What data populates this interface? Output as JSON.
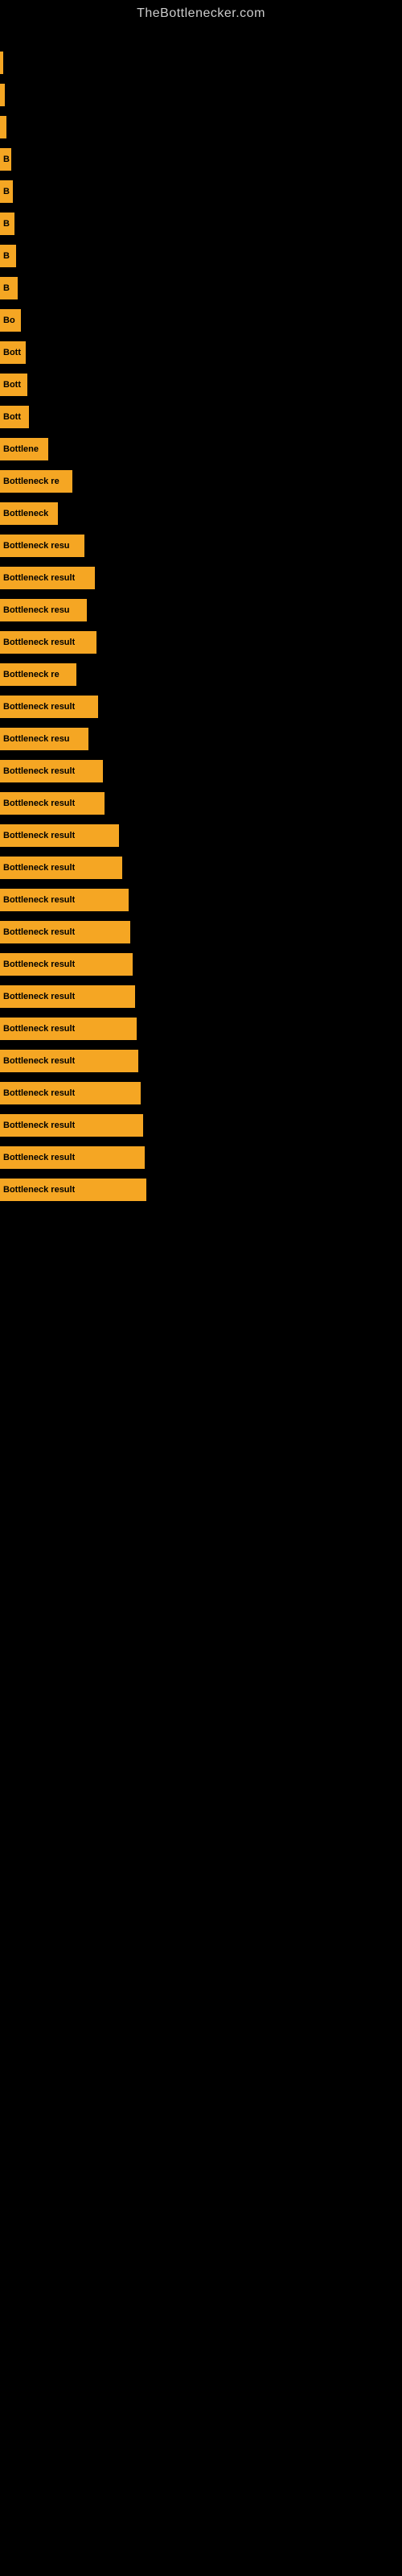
{
  "site": {
    "title": "TheBottlenecker.com"
  },
  "bars": [
    {
      "label": "",
      "width": 4
    },
    {
      "label": "",
      "width": 6
    },
    {
      "label": "",
      "width": 8
    },
    {
      "label": "B",
      "width": 14
    },
    {
      "label": "B",
      "width": 16
    },
    {
      "label": "B",
      "width": 18
    },
    {
      "label": "B",
      "width": 20
    },
    {
      "label": "B",
      "width": 22
    },
    {
      "label": "Bo",
      "width": 26
    },
    {
      "label": "Bott",
      "width": 32
    },
    {
      "label": "Bott",
      "width": 34
    },
    {
      "label": "Bott",
      "width": 36
    },
    {
      "label": "Bottlene",
      "width": 60
    },
    {
      "label": "Bottleneck re",
      "width": 90
    },
    {
      "label": "Bottleneck",
      "width": 72
    },
    {
      "label": "Bottleneck resu",
      "width": 105
    },
    {
      "label": "Bottleneck result",
      "width": 118
    },
    {
      "label": "Bottleneck resu",
      "width": 108
    },
    {
      "label": "Bottleneck result",
      "width": 120
    },
    {
      "label": "Bottleneck re",
      "width": 95
    },
    {
      "label": "Bottleneck result",
      "width": 122
    },
    {
      "label": "Bottleneck resu",
      "width": 110
    },
    {
      "label": "Bottleneck result",
      "width": 128
    },
    {
      "label": "Bottleneck result",
      "width": 130
    },
    {
      "label": "Bottleneck result",
      "width": 148
    },
    {
      "label": "Bottleneck result",
      "width": 152
    },
    {
      "label": "Bottleneck result",
      "width": 160
    },
    {
      "label": "Bottleneck result",
      "width": 162
    },
    {
      "label": "Bottleneck result",
      "width": 165
    },
    {
      "label": "Bottleneck result",
      "width": 168
    },
    {
      "label": "Bottleneck result",
      "width": 170
    },
    {
      "label": "Bottleneck result",
      "width": 172
    },
    {
      "label": "Bottleneck result",
      "width": 175
    },
    {
      "label": "Bottleneck result",
      "width": 178
    },
    {
      "label": "Bottleneck result",
      "width": 180
    },
    {
      "label": "Bottleneck result",
      "width": 182
    }
  ]
}
